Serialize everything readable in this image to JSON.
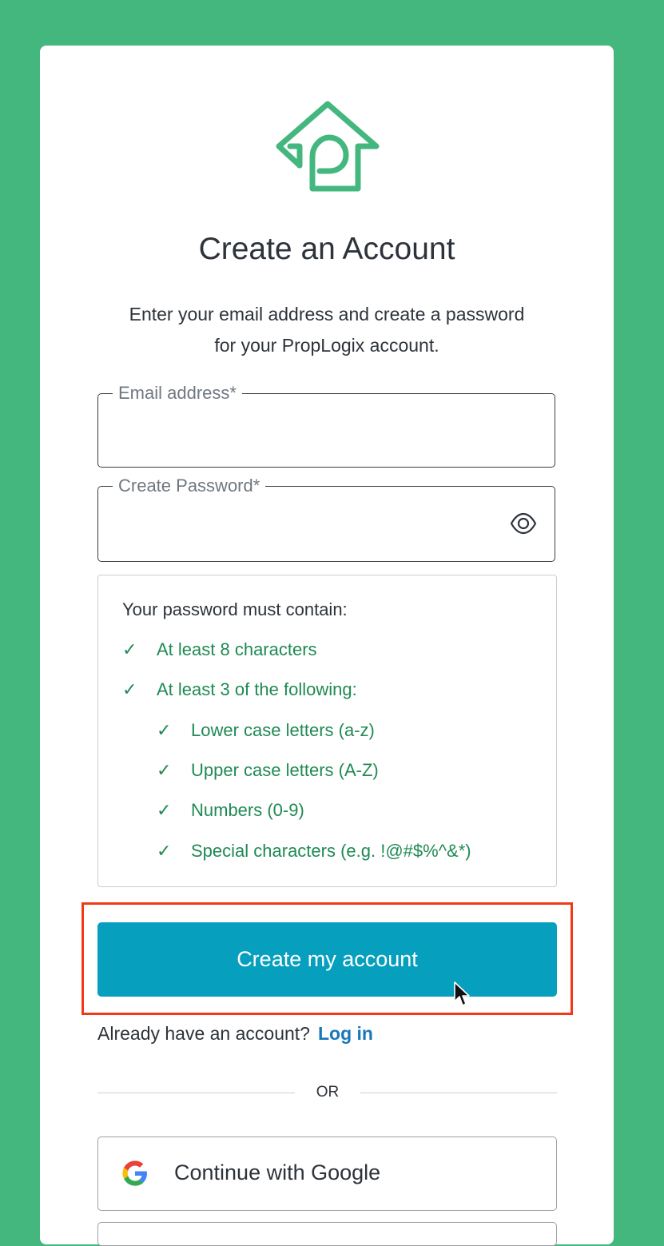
{
  "brand": {
    "logo_icon": "proplogix-house-logo-icon",
    "accent_color": "#44b77f"
  },
  "header": {
    "title": "Create an Account",
    "subtitle_line1": "Enter your email address and create a password",
    "subtitle_line2": "for your PropLogix account."
  },
  "form": {
    "email": {
      "label": "Email address*",
      "value": ""
    },
    "password": {
      "label": "Create Password*",
      "value": "",
      "toggle_icon": "eye-icon"
    }
  },
  "password_rules": {
    "heading": "Your password must contain:",
    "check_symbol": "✓",
    "items": [
      {
        "text": "At least 8 characters"
      },
      {
        "text": "At least 3 of the following:"
      },
      {
        "text": "Lower case letters (a-z)"
      },
      {
        "text": "Upper case letters (A-Z)"
      },
      {
        "text": "Numbers (0-9)"
      },
      {
        "text": "Special characters (e.g. !@#$%^&*)"
      }
    ],
    "status_color": "#1f8a53"
  },
  "actions": {
    "create_label": "Create my account",
    "create_color": "#079fbe",
    "already_text": "Already have an account?",
    "login_label": "Log in",
    "or_text": "OR",
    "google_label": "Continue with Google"
  },
  "annotation": {
    "highlight_color": "#f03a17"
  }
}
